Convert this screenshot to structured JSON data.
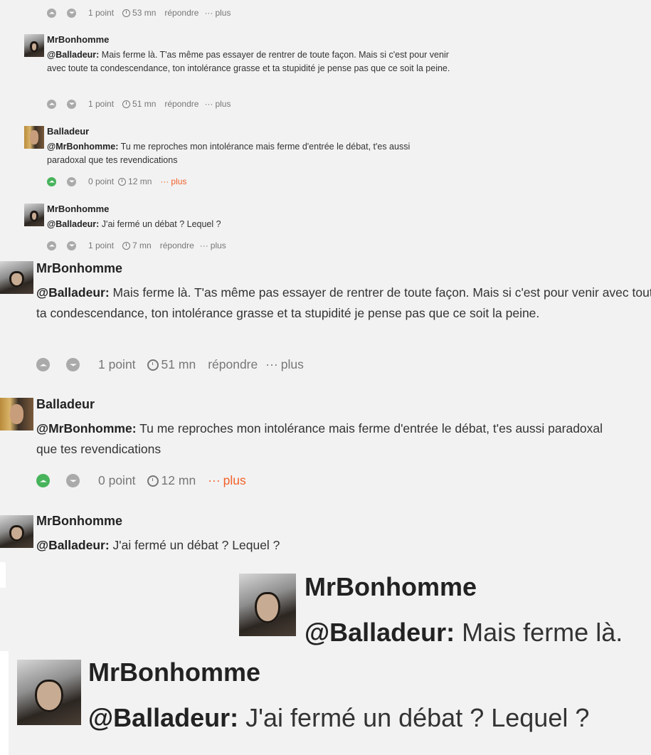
{
  "small": {
    "c0": {
      "points": "1 point",
      "time": "53 mn",
      "reply": "répondre",
      "more": "plus"
    },
    "c1": {
      "user": "MrBonhomme",
      "mention": "@Balladeur:",
      "body": " Mais ferme là. T'as même pas essayer de rentrer de toute façon. Mais si c'est pour venir avec toute ta condescendance, ton intolérance grasse et ta stupidité je pense pas que ce soit la peine.",
      "points": "1 point",
      "time": "51 mn",
      "reply": "répondre",
      "more": "plus"
    },
    "c2": {
      "user": "Balladeur",
      "mention": "@MrBonhomme:",
      "body": " Tu me reproches mon intolérance mais ferme d'entrée le débat, t'es aussi paradoxal que tes revendications",
      "points": "0 point",
      "time": "12 mn",
      "more": "plus"
    },
    "c3": {
      "user": "MrBonhomme",
      "mention": "@Balladeur:",
      "body": " J'ai fermé un débat ? Lequel ?",
      "points": "1 point",
      "time": "7 mn",
      "reply": "répondre",
      "more": "plus"
    }
  },
  "medium": {
    "c1": {
      "user": "MrBonhomme",
      "mention": "@Balladeur:",
      "body": " Mais ferme là. T'as même pas essayer de rentrer de toute façon. Mais si c'est pour venir avec toute ta condescendance, ton intolérance grasse et ta stupidité je pense pas que ce soit la peine.",
      "points": "1 point",
      "time": "51 mn",
      "reply": "répondre",
      "more": "plus"
    },
    "c2": {
      "user": "Balladeur",
      "mention": "@MrBonhomme:",
      "body": " Tu me reproches mon intolérance mais ferme d'entrée le débat, t'es aussi paradoxal que tes revendications",
      "points": "0 point",
      "time": "12 mn",
      "more": "plus"
    },
    "c3": {
      "user": "MrBonhomme",
      "mention": "@Balladeur:",
      "body": " J'ai fermé un débat ? Lequel ?"
    }
  },
  "large": {
    "c1": {
      "user": "MrBonhomme",
      "mention": "@Balladeur:",
      "body": " Mais ferme là."
    },
    "c2": {
      "user": "MrBonhomme",
      "mention": "@Balladeur:",
      "body": " J'ai fermé un débat ? Lequel ?"
    }
  },
  "icons": {
    "up": "upvote-icon",
    "down": "downvote-icon",
    "clock": "clock-icon",
    "dots": "more-dots-icon"
  },
  "colors": {
    "upvoted": "#47b35b",
    "accent": "#f1612a"
  }
}
